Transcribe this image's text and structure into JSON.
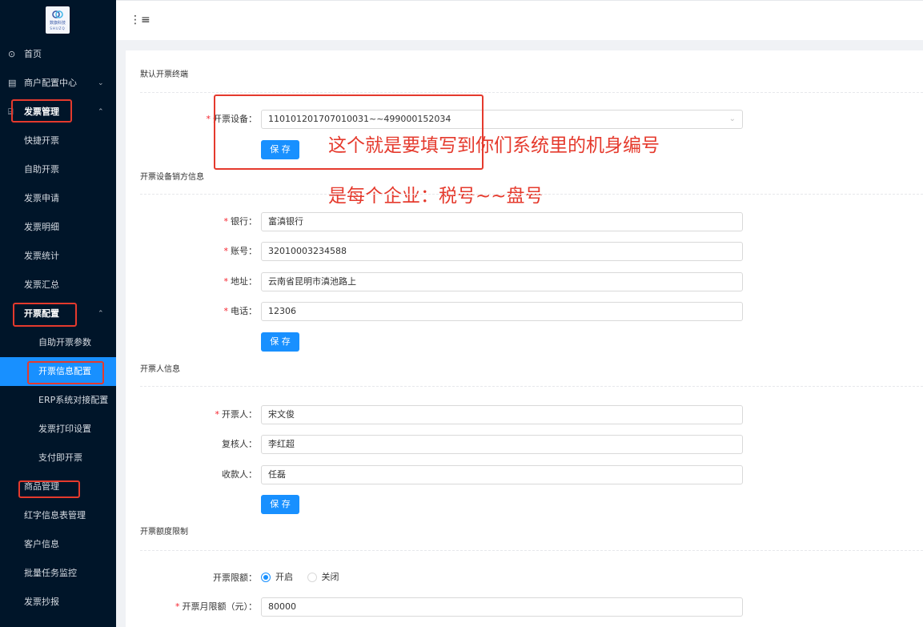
{
  "logo": {
    "line1": "数旗科技",
    "line2": "SHUZQ"
  },
  "sidebar": {
    "items": [
      {
        "icon": "home-icon",
        "glyph": "⊙",
        "label": "首页",
        "arrow": ""
      },
      {
        "icon": "merchant-icon",
        "glyph": "▤",
        "label": "商户配置中心",
        "arrow": "⌄"
      },
      {
        "icon": "invoice-icon",
        "glyph": "⌸",
        "label": "发票管理",
        "arrow": "⌃"
      },
      {
        "label": "快捷开票"
      },
      {
        "label": "自助开票"
      },
      {
        "label": "发票申请"
      },
      {
        "label": "发票明细"
      },
      {
        "label": "发票统计"
      },
      {
        "label": "发票汇总"
      },
      {
        "label": "开票配置",
        "arrow": "⌃"
      },
      {
        "label": "自助开票参数"
      },
      {
        "label": "开票信息配置"
      },
      {
        "label": "ERP系统对接配置"
      },
      {
        "label": "发票打印设置"
      },
      {
        "label": "支付即开票"
      },
      {
        "label": "商品管理"
      },
      {
        "label": "红字信息表管理"
      },
      {
        "label": "客户信息"
      },
      {
        "label": "批量任务监控"
      },
      {
        "label": "发票抄报"
      }
    ]
  },
  "topbar": {
    "fold_icon": "⋮≡"
  },
  "sections": {
    "terminal": {
      "title": "默认开票终端",
      "device_label": "开票设备：",
      "device_value": "110101201707010031~~499000152034",
      "save": "保 存"
    },
    "seller": {
      "title": "开票设备销方信息",
      "bank_label": "银行：",
      "bank_value": "富滇银行",
      "account_label": "账号：",
      "account_value": "32010003234588",
      "address_label": "地址：",
      "address_value": "云南省昆明市滇池路上",
      "phone_label": "电话：",
      "phone_value": "12306",
      "save": "保 存"
    },
    "drawer": {
      "title": "开票人信息",
      "drawer_label": "开票人：",
      "drawer_value": "宋文俊",
      "reviewer_label": "复核人：",
      "reviewer_value": "李红超",
      "payee_label": "收款人：",
      "payee_value": "任磊",
      "save": "保 存"
    },
    "limit": {
      "title": "开票额度限制",
      "limit_label": "开票限额：",
      "option_on": "开启",
      "option_off": "关闭",
      "selected": "开启",
      "monthly_label": "开票月限额（元）：",
      "monthly_value": "80000"
    }
  },
  "annotations": {
    "line1": "这个就是要填写到你们系统里的机身编号",
    "line2": "是每个企业：税号~~盘号",
    "color": "#e53a2d"
  },
  "colors": {
    "sidebar_bg": "#001529",
    "accent": "#1890ff",
    "required": "#f5222d"
  }
}
